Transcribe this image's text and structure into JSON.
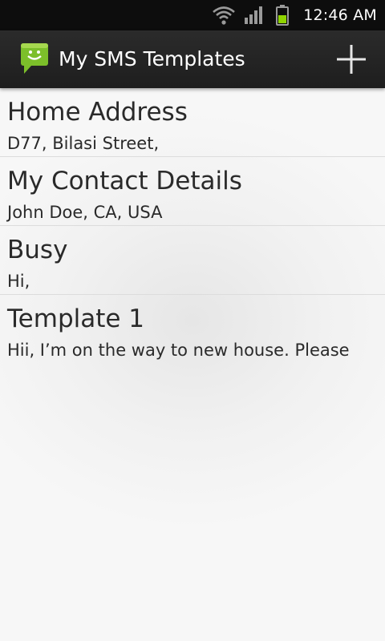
{
  "status_bar": {
    "time": "12:46 AM",
    "icons": [
      "wifi-icon",
      "signal-icon",
      "battery-icon"
    ],
    "battery_color": "#8fd400"
  },
  "action_bar": {
    "title": "My SMS Templates",
    "app_icon": "sms-chat-icon",
    "app_icon_color": "#7cbf2a",
    "add_icon": "plus-icon"
  },
  "templates": [
    {
      "title": "Home Address",
      "body": "D77, Bilasi Street,"
    },
    {
      "title": "My Contact Details",
      "body": "John Doe, CA, USA"
    },
    {
      "title": "Busy",
      "body": "Hi,"
    },
    {
      "title": "Template 1",
      "body": "Hii, I’m on the way to new house. Please"
    }
  ]
}
